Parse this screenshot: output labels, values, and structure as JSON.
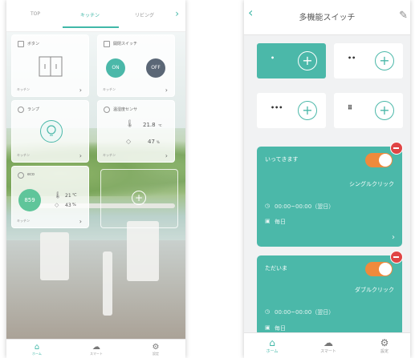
{
  "left": {
    "tabs": [
      "TOP",
      "キッチン",
      "リビング"
    ],
    "tabs_chevron": "chevron-right-icon",
    "tiles": {
      "button": {
        "title": "ボタン",
        "room": "キッチン"
      },
      "switch": {
        "title": "開閉スイッチ",
        "on_label": "ON",
        "off_label": "OFF",
        "room": "キッチン"
      },
      "lamp": {
        "title": "ランプ",
        "room": "キッチン"
      },
      "sensor": {
        "title": "温湿度センサ",
        "temp": "21.8",
        "temp_unit": "℃",
        "humidity": "47",
        "humidity_unit": "%",
        "room": "キッチン"
      },
      "eco": {
        "title": "eco",
        "value": "859",
        "temp": "21",
        "temp_unit": "℃",
        "humidity": "43",
        "humidity_unit": "%",
        "room": "キッチン"
      }
    },
    "bottom_nav": [
      "ホーム",
      "スマート",
      "設定"
    ]
  },
  "right": {
    "title": "多機能スイッチ",
    "buttons": [
      {
        "dots": "•"
      },
      {
        "dots": "••"
      },
      {
        "dots": "•••"
      },
      {
        "dots": "⠿"
      }
    ],
    "cards": [
      {
        "name": "いってきます",
        "action": "シングルクリック",
        "time": "00:00~00:00（翌日）",
        "repeat": "毎日"
      },
      {
        "name": "ただいま",
        "action": "ダブルクリック",
        "time": "00:00~00:00（翌日）",
        "repeat": "毎日"
      }
    ],
    "bottom_nav": [
      "ホーム",
      "スマート",
      "設定"
    ]
  },
  "colors": {
    "teal": "#4bb8a9",
    "orange": "#ef8a3c",
    "red": "#e04545"
  }
}
